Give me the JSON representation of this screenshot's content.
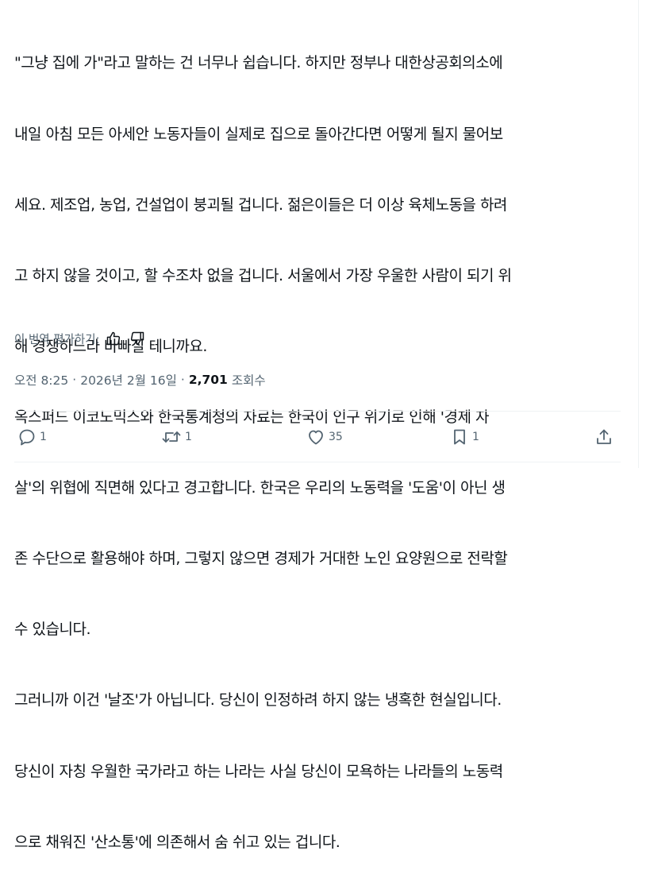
{
  "tweet": {
    "lines": [
      "\"그냥 집에 가\"라고 말하는 건 너무나 쉽습니다. 하지만 정부나 대한상공회의소에",
      "내일 아침 모든 아세안 노동자들이 실제로 집으로 돌아간다면 어떻게 될지 물어보",
      "세요. 제조업, 농업, 건설업이 붕괴될 겁니다. 젊은이들은 더 이상 육체노동을 하려",
      "고 하지 않을 것이고, 할 수조차 없을 겁니다. 서울에서 가장 우울한 사람이 되기 위",
      "해 경쟁하느라 바빠질 테니까요.",
      "옥스퍼드 이코노믹스와 한국통계청의 자료는 한국이 인구 위기로 인해 '경제 자",
      "살'의 위협에 직면해 있다고 경고합니다. 한국은 우리의 노동력을 '도움'이 아닌 생",
      "존 수단으로 활용해야 하며, 그렇지 않으면 경제가 거대한 노인 요양원으로 전락할",
      "수 있습니다.",
      "그러니까 이건 '날조'가 아닙니다. 당신이 인정하려 하지 않는 냉혹한 현실입니다.",
      "당신이 자칭 우월한 국가라고 하는 나라는 사실 당신이 모욕하는 나라들의 노동력",
      "으로 채워진 '산소통'에 의존해서 숨 쉬고 있는 겁니다."
    ]
  },
  "translation": {
    "rate_label": "이 번역 평가하기:"
  },
  "meta": {
    "time": "오전 8:25",
    "separator": "·",
    "date": "2026년 2월 16일",
    "views_count": "2,701",
    "views_label": "조회수"
  },
  "actions": {
    "reply_count": "1",
    "retweet_count": "1",
    "like_count": "35",
    "bookmark_count": "1"
  },
  "colors": {
    "text": "#0f1419",
    "secondary": "#536471",
    "border": "#eff3f4"
  }
}
